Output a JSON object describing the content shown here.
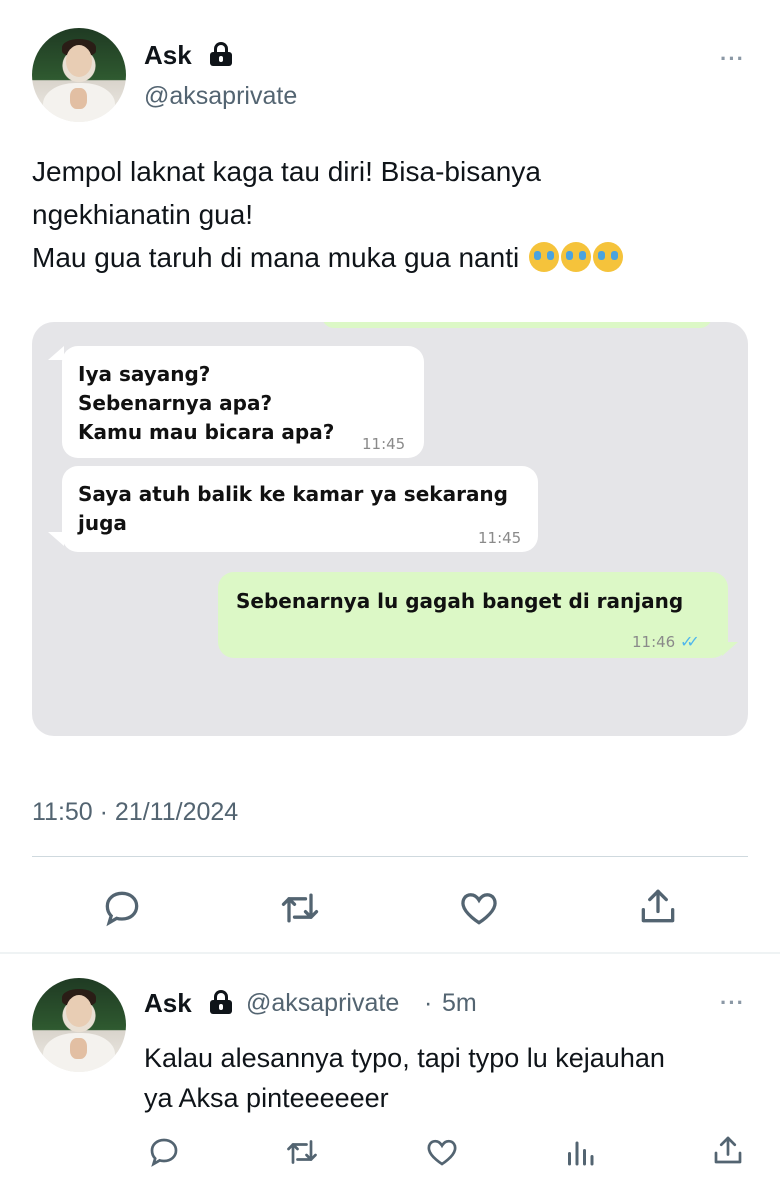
{
  "main_tweet": {
    "author_name": "Ask",
    "author_handle": "@aksaprivate",
    "more_label": "···",
    "text_lines": [
      "Jempol laknat kaga tau diri! Bisa-bisanya",
      "ngekhianatin gua!",
      "Mau gua taruh di mana muka gua nanti"
    ],
    "emoji": [
      "loudly-crying-face",
      "loudly-crying-face",
      "loudly-crying-face"
    ],
    "timestamp": "11:50 · 21/11/2024",
    "actions": [
      "reply",
      "retweet",
      "like",
      "share"
    ]
  },
  "chat_screenshot": {
    "messages": [
      {
        "direction": "incoming",
        "lines": [
          "Iya sayang?",
          "Sebenarnya apa?",
          "Kamu mau bicara apa?"
        ],
        "time": "11:45"
      },
      {
        "direction": "incoming",
        "lines": [
          "Saya atuh balik ke kamar ya sekarang",
          "juga"
        ],
        "time": "11:45"
      },
      {
        "direction": "outgoing",
        "lines": [
          "Sebenarnya lu gagah banget di ranjang"
        ],
        "time": "11:46",
        "read": true
      }
    ]
  },
  "reply_tweet": {
    "author_name": "Ask",
    "author_handle": "@aksaprivate",
    "separator": "·",
    "age": "5m",
    "more_label": "···",
    "text_lines": [
      "Kalau alesannya typo, tapi typo lu kejauhan",
      "ya Aksa pinteeeeeer"
    ],
    "actions": [
      "reply",
      "retweet",
      "like",
      "views",
      "share"
    ]
  },
  "colors": {
    "text_primary": "#0f1419",
    "text_secondary": "#536471",
    "chat_background": "#e5e5e8",
    "incoming_bubble": "#ffffff",
    "outgoing_bubble": "#dcf8c6",
    "read_ticks": "#4fb6ec"
  }
}
